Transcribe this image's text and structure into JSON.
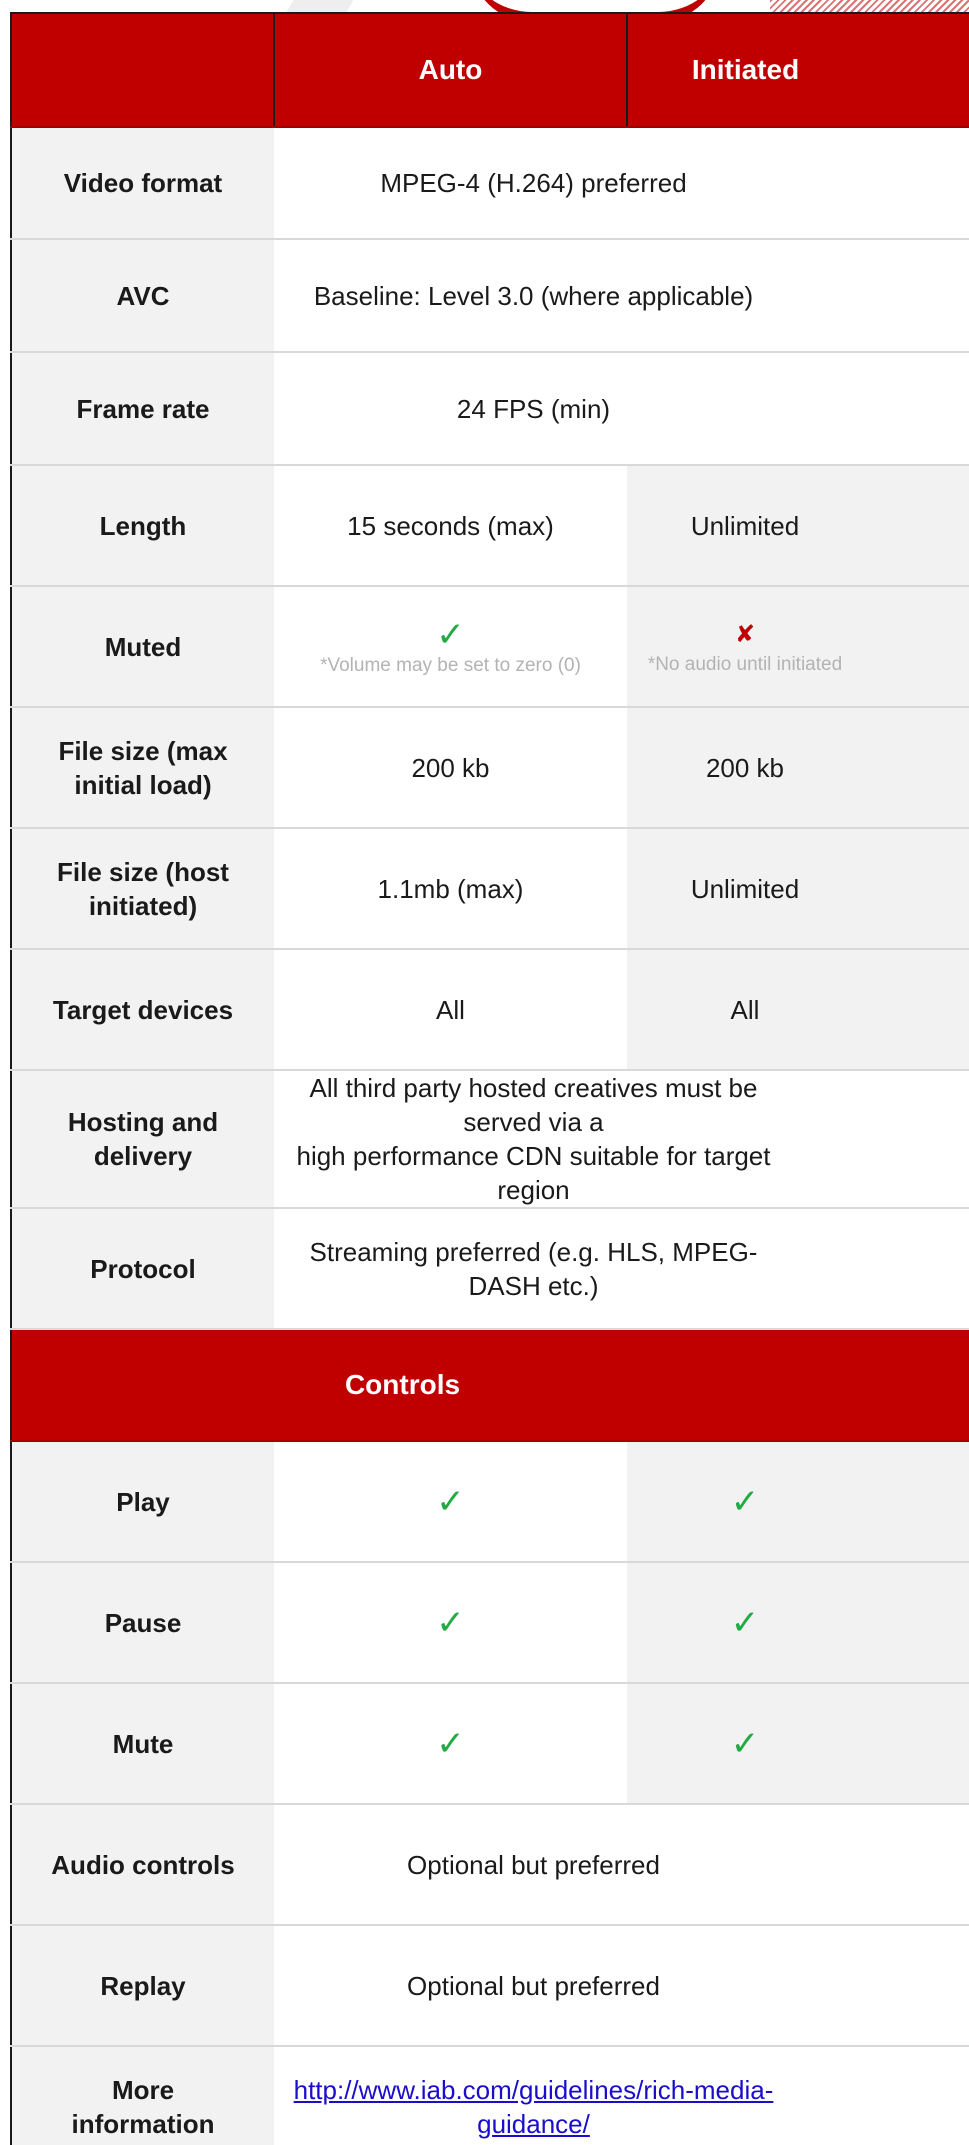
{
  "header": {
    "col_auto": "Auto",
    "col_initiated": "Initiated"
  },
  "rows": {
    "video_format": {
      "label": "Video format",
      "value": "MPEG-4 (H.264)  preferred"
    },
    "avc": {
      "label": "AVC",
      "value": "Baseline: Level 3.0 (where applicable)"
    },
    "frame_rate": {
      "label": "Frame rate",
      "value": "24 FPS (min)"
    },
    "length": {
      "label": "Length",
      "auto": "15 seconds (max)",
      "initiated": "Unlimited"
    },
    "muted": {
      "label": "Muted",
      "auto_note": "*Volume may be set to zero (0)",
      "initiated_note": "*No audio until initiated"
    },
    "file_size_initial": {
      "label_line1": "File size (max",
      "label_line2": "initial load)",
      "auto": "200 kb",
      "initiated": "200 kb"
    },
    "file_size_host": {
      "label_line1": "File size (host",
      "label_line2": "initiated)",
      "auto": "1.1mb (max)",
      "initiated": "Unlimited"
    },
    "target_devices": {
      "label": "Target devices",
      "auto": "All",
      "initiated": "All"
    },
    "hosting": {
      "label_line1": "Hosting and",
      "label_line2": "delivery",
      "value_line1": "All third party hosted creatives must be served via a",
      "value_line2": "high performance CDN suitable for target region"
    },
    "protocol": {
      "label": "Protocol",
      "value": "Streaming preferred (e.g. HLS, MPEG-DASH etc.)"
    }
  },
  "controls": {
    "title": "Controls",
    "play": {
      "label": "Play"
    },
    "pause": {
      "label": "Pause"
    },
    "mute": {
      "label": "Mute"
    },
    "audio_controls": {
      "label": "Audio controls",
      "value": "Optional but preferred"
    },
    "replay": {
      "label": "Replay",
      "value": "Optional but preferred"
    },
    "more_info": {
      "label_line1": "More",
      "label_line2": "information",
      "link_text": "http://www.iab.com/guidelines/rich-media-guidance/"
    }
  },
  "icons": {
    "check": "✓",
    "cross": "✘"
  },
  "colors": {
    "brand_red": "#c00000",
    "check_green": "#22aa44",
    "label_bg": "#f2f2f2",
    "note_grey": "#b3b3b3",
    "link_blue": "#1a0dcc"
  }
}
